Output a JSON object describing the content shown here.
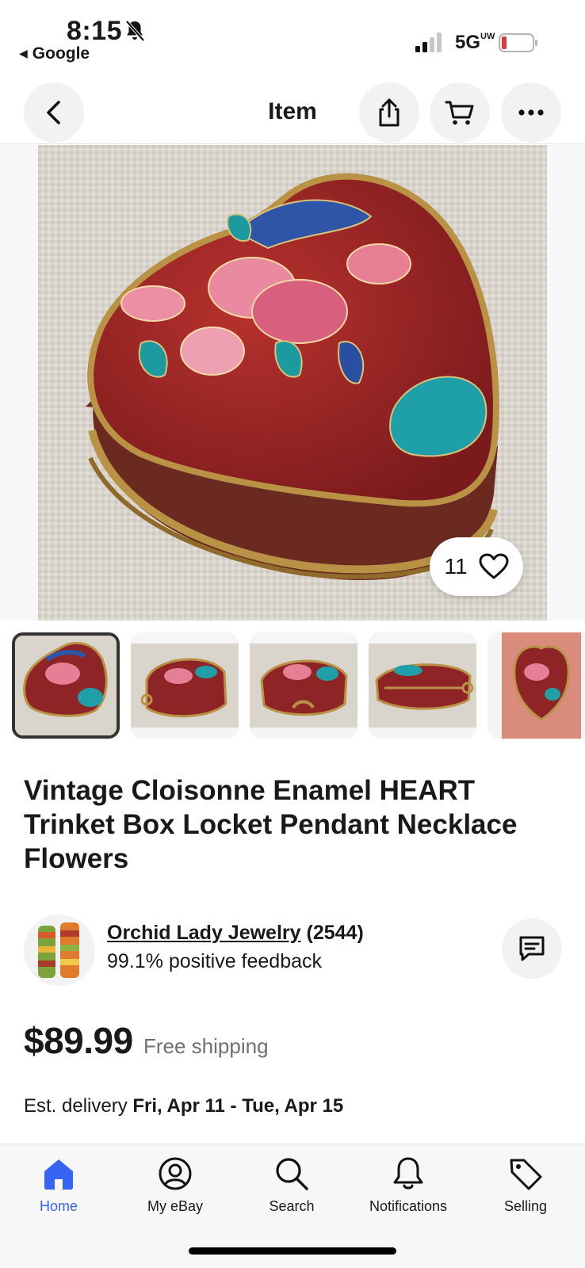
{
  "status_bar": {
    "time": "8:15",
    "back_app": "Google",
    "network": "5G",
    "network_sup": "UW",
    "battery_color": "#e53935"
  },
  "header": {
    "title": "Item",
    "icons": [
      "back-chevron-icon",
      "share-icon",
      "cart-icon",
      "more-icon"
    ]
  },
  "gallery": {
    "like_count": "11",
    "thumbnail_count": 5,
    "selected_index": 0
  },
  "listing": {
    "title": "Vintage Cloisonne Enamel HEART Trinket Box Locket Pendant Necklace Flowers"
  },
  "seller": {
    "name": "Orchid Lady Jewelry",
    "score": "(2544)",
    "feedback": "99.1% positive feedback"
  },
  "pricing": {
    "price": "$89.99",
    "shipping": "Free shipping",
    "delivery_prefix": "Est. delivery",
    "delivery_range": "Fri, Apr 11 - Tue, Apr 15"
  },
  "tabbar": {
    "items": [
      {
        "label": "Home",
        "icon": "home-icon",
        "active": true
      },
      {
        "label": "My eBay",
        "icon": "user-icon",
        "active": false
      },
      {
        "label": "Search",
        "icon": "search-icon",
        "active": false
      },
      {
        "label": "Notifications",
        "icon": "bell-icon",
        "active": false
      },
      {
        "label": "Selling",
        "icon": "tag-icon",
        "active": false
      }
    ]
  },
  "colors": {
    "accent": "#3665f3",
    "text": "#191919",
    "muted": "#707070"
  }
}
